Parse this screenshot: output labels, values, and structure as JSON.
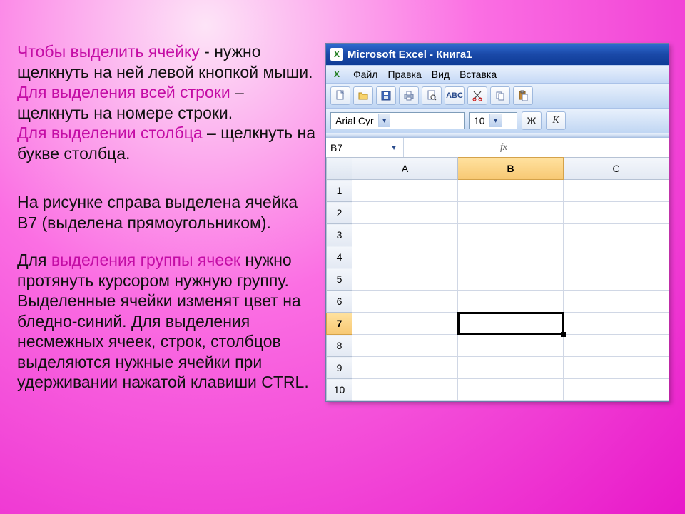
{
  "text": {
    "p1_a": "Чтобы выделить ячейку",
    "p1_b": "  -  нужно щелкнуть на ней левой кнопкой мыши.",
    "p2_a": "Для выделения всей строки",
    "p2_b": " – щелкнуть на номере строки.",
    "p3_a": "Для выделении столбца",
    "p3_b": " – щелкнуть на букве столбца.",
    "p4": "На рисунке справа выделена ячейка B7 (выделена прямоугольником).",
    "p5_a": "Для ",
    "p5_b": "выделения группы ячеек",
    "p5_c": " нужно протянуть курсором нужную группу. Выделенные ячейки изменят цвет на бледно-синий. Для выделения несмежных ячеек, строк, столбцов выделяются нужные ячейки при удерживании нажатой клавиши CTRL."
  },
  "excel": {
    "title": "Microsoft Excel - Книга1",
    "menu": [
      "Файл",
      "Правка",
      "Вид",
      "Вставка"
    ],
    "font_name": "Arial Cyr",
    "font_size": "10",
    "bold": "Ж",
    "italic": "К",
    "active_cell": "B7",
    "fx": "fx",
    "columns": [
      "A",
      "B",
      "C"
    ],
    "rows": [
      1,
      2,
      3,
      4,
      5,
      6,
      7,
      8,
      9,
      10
    ],
    "selected_col": "B",
    "selected_row": 7
  }
}
